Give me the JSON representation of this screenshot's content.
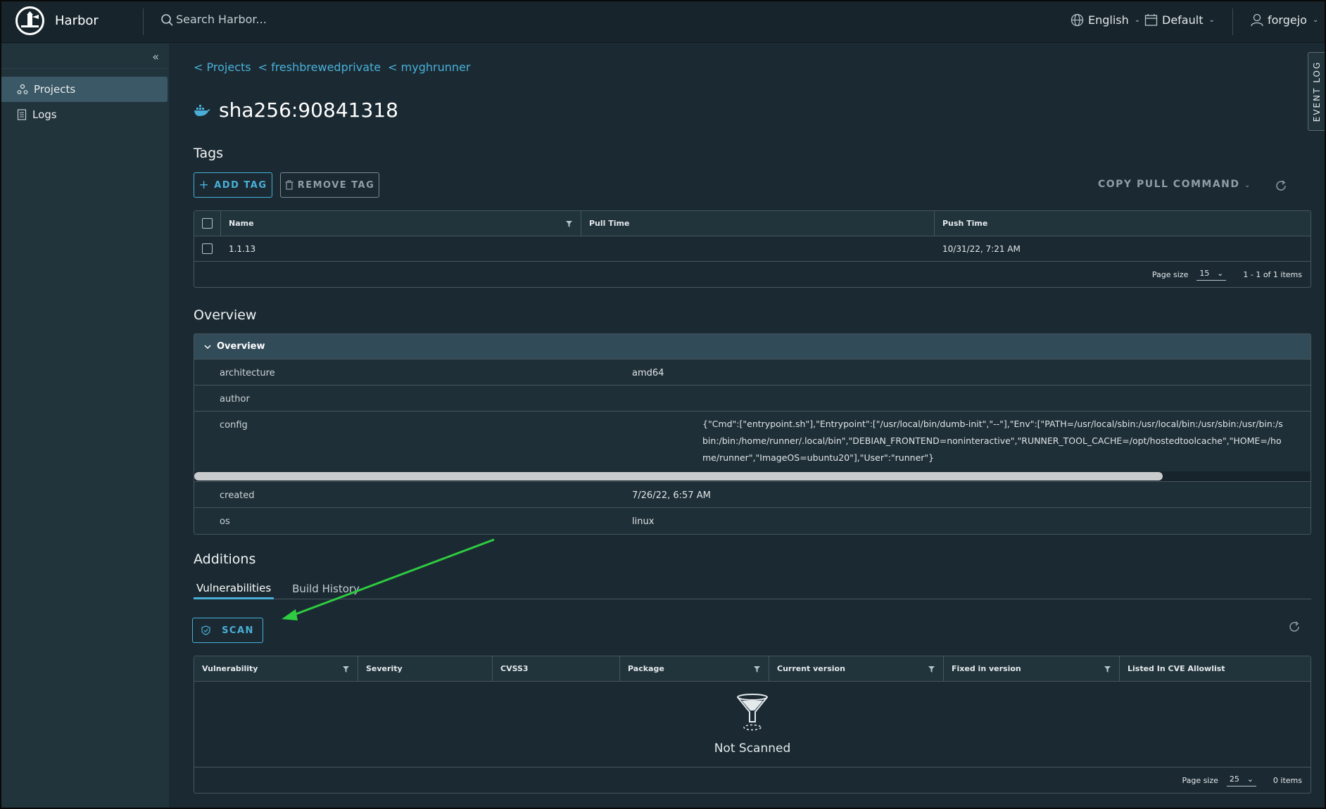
{
  "header": {
    "brand": "Harbor",
    "search_placeholder": "Search Harbor...",
    "language": "English",
    "theme": "Default",
    "user": "forgejo"
  },
  "sidebar": {
    "items": [
      {
        "label": "Projects",
        "icon": "projects-icon",
        "active": true
      },
      {
        "label": "Logs",
        "icon": "logs-icon",
        "active": false
      }
    ]
  },
  "breadcrumb": [
    "< Projects",
    "< freshbrewedprivate",
    "< myghrunner"
  ],
  "artifact": {
    "title": "sha256:90841318"
  },
  "tags": {
    "section_title": "Tags",
    "add_tag": "ADD TAG",
    "remove_tag": "REMOVE TAG",
    "copy_pull": "COPY PULL COMMAND",
    "columns": [
      "Name",
      "Pull Time",
      "Push Time"
    ],
    "rows": [
      {
        "name": "1.1.13",
        "pull_time": "",
        "push_time": "10/31/22, 7:21 AM"
      }
    ],
    "page_size_label": "Page size",
    "page_size": "15",
    "items_label": "1 - 1 of 1 items"
  },
  "overview": {
    "section_title": "Overview",
    "header": "Overview",
    "rows": [
      {
        "key": "architecture",
        "value": "amd64"
      },
      {
        "key": "author",
        "value": ""
      },
      {
        "key": "config",
        "value": "{\"Cmd\":[\"entrypoint.sh\"],\"Entrypoint\":[\"/usr/local/bin/dumb-init\",\"--\"],\"Env\":[\"PATH=/usr/local/sbin:/usr/local/bin:/usr/sbin:/usr/bin:/sbin:/bin:/home/runner/.local/bin\",\"DEBIAN_FRONTEND=noninteractive\",\"RUNNER_TOOL_CACHE=/opt/hostedtoolcache\",\"HOME=/home/runner\",\"ImageOS=ubuntu20\"],\"User\":\"runner\"}"
      },
      {
        "key": "created",
        "value": "7/26/22, 6:57 AM"
      },
      {
        "key": "os",
        "value": "linux"
      }
    ]
  },
  "additions": {
    "section_title": "Additions",
    "tabs": [
      "Vulnerabilities",
      "Build History"
    ],
    "scan": "SCAN",
    "columns": [
      "Vulnerability",
      "Severity",
      "CVSS3",
      "Package",
      "Current version",
      "Fixed in version",
      "Listed In CVE Allowlist"
    ],
    "empty_text": "Not Scanned",
    "page_size_label": "Page size",
    "page_size": "25",
    "items_label": "0 items"
  },
  "event_log": "EVENT LOG",
  "colors": {
    "accent": "#49afd9",
    "background": "#1b2a32",
    "header": "#17242b",
    "annotation_arrow": "#2ecc40"
  }
}
